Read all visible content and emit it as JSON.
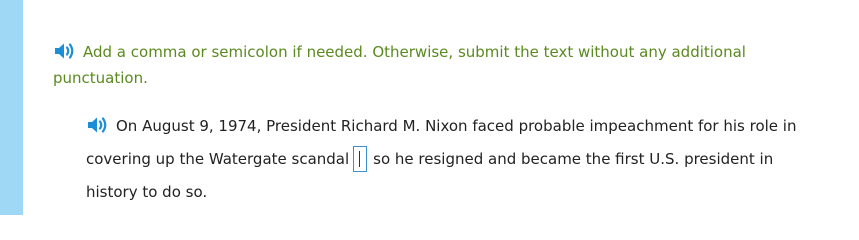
{
  "instruction": {
    "icon": "speaker-icon",
    "text": "Add a comma or semicolon if needed. Otherwise, submit the text without any additional punctuation."
  },
  "sentence": {
    "icon": "speaker-icon",
    "before_blank": "On August 9, 1974, President Richard M. Nixon faced probable impeachment for his role in covering up the Watergate scandal",
    "blank_value": "",
    "after_blank": "so he resigned and became the first U.S. president in history to do so."
  },
  "colors": {
    "left_bar": "#9fd8f5",
    "instruction_text": "#5a8a1f",
    "speaker_icon": "#1a8fd8",
    "blank_border": "#3d8fd0"
  }
}
